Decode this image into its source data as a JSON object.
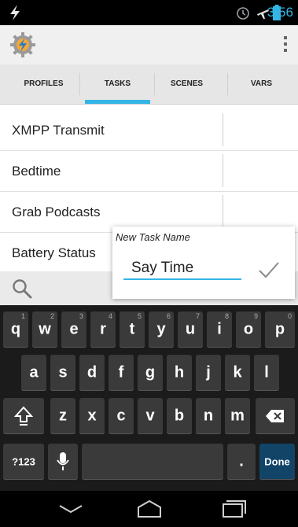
{
  "status": {
    "time": "3:56",
    "icons": [
      "flash-icon",
      "alarm-icon",
      "airplane-icon",
      "battery-icon"
    ]
  },
  "app": {
    "logo": "tasker-gear-logo",
    "overflow_icon": "overflow-menu-icon"
  },
  "tabs": [
    {
      "label": "PROFILES",
      "active": false
    },
    {
      "label": "TASKS",
      "active": true
    },
    {
      "label": "SCENES",
      "active": false
    },
    {
      "label": "VARS",
      "active": false
    }
  ],
  "tasks": [
    {
      "label": "XMPP Transmit"
    },
    {
      "label": "Bedtime"
    },
    {
      "label": "Grab Podcasts"
    },
    {
      "label": "Battery Status"
    }
  ],
  "dialog": {
    "title": "New Task Name",
    "value": "Say Time",
    "confirm_icon": "checkmark-icon"
  },
  "keyboard": {
    "row1": [
      {
        "key": "q",
        "alt": "1"
      },
      {
        "key": "w",
        "alt": "2"
      },
      {
        "key": "e",
        "alt": "3"
      },
      {
        "key": "r",
        "alt": "4"
      },
      {
        "key": "t",
        "alt": "5"
      },
      {
        "key": "y",
        "alt": "6"
      },
      {
        "key": "u",
        "alt": "7"
      },
      {
        "key": "i",
        "alt": "8"
      },
      {
        "key": "o",
        "alt": "9"
      },
      {
        "key": "p",
        "alt": "0"
      }
    ],
    "row2": [
      "a",
      "s",
      "d",
      "f",
      "g",
      "h",
      "j",
      "k",
      "l"
    ],
    "row3": [
      "z",
      "x",
      "c",
      "v",
      "b",
      "n",
      "m"
    ],
    "symbols_key": "?123",
    "period_key": ".",
    "done_key": "Done"
  },
  "colors": {
    "accent": "#33b5e5",
    "keyboard_bg": "#1b1b1b",
    "key_bg": "#3a3a3a",
    "done_bg": "#124468"
  }
}
